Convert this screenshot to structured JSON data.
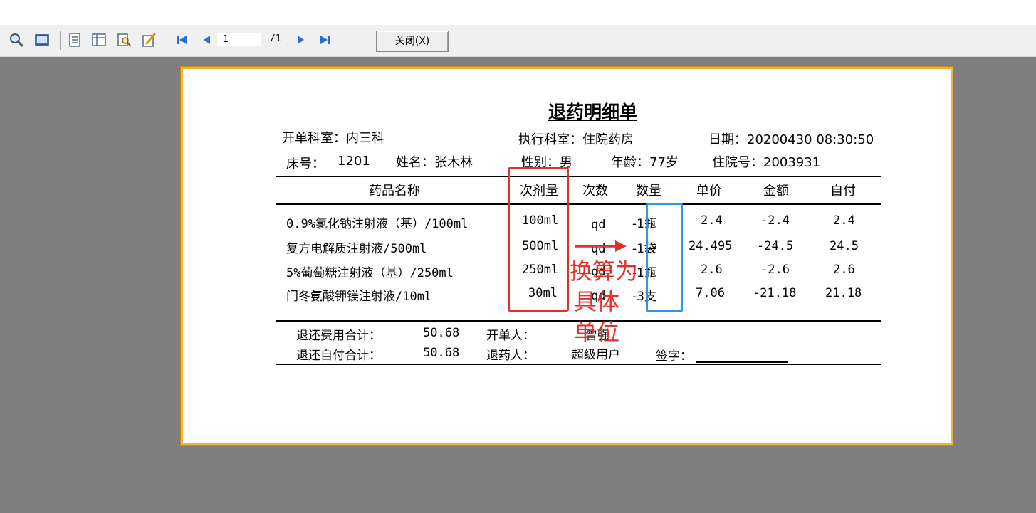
{
  "toolbar": {
    "page_current": "1",
    "page_total": "/1",
    "close_label": "关闭(X)"
  },
  "doc": {
    "title": "退药明细单",
    "dept_label": "开单科室：内三科",
    "exec_dept_label": "执行科室：住院药房",
    "date_label": "日期：20200430 08:30:50",
    "bed_label": "床号：",
    "bed_value": "1201",
    "name_label": "姓名：张木林",
    "sex_label": "性别：男",
    "age_label": "年龄：77岁",
    "admission_label": "住院号：2003931",
    "headers": [
      "药品名称",
      "次剂量",
      "次数",
      "数量",
      "单价",
      "金额",
      "自付"
    ],
    "rows": [
      {
        "name": "0.9%氯化钠注射液（基）/100ml",
        "dose": "100ml",
        "freq": "qd",
        "qty": "-1瓶",
        "price": "2.4",
        "amount": "-2.4",
        "self": "2.4"
      },
      {
        "name": "复方电解质注射液/500ml",
        "dose": "500ml",
        "freq": "qd",
        "qty": "-1袋",
        "price": "24.495",
        "amount": "-24.5",
        "self": "24.5"
      },
      {
        "name": "5%葡萄糖注射液（基）/250ml",
        "dose": "250ml",
        "freq": "qd",
        "qty": "-1瓶",
        "price": "2.6",
        "amount": "-2.6",
        "self": "2.6"
      },
      {
        "name": "门冬氨酸钾镁注射液/10ml",
        "dose": "30ml",
        "freq": "qd",
        "qty": "-3支",
        "price": "7.06",
        "amount": "-21.18",
        "self": "21.18"
      }
    ],
    "footer": {
      "refund_total_label": "退还费用合计：",
      "refund_total_value": "50.68",
      "self_total_label": "退还自付合计：",
      "self_total_value": "50.68",
      "issuer_label": "开单人：",
      "issuer_value": "曾强",
      "returner_label": "退药人：",
      "returner_value": "超级用户",
      "signature_label": "签字："
    }
  },
  "annotation": {
    "text_line1": "换算为",
    "text_line2": "具体",
    "text_line3": "单位",
    "red": "#e0312b",
    "blue": "#2e96e8"
  },
  "colors": {
    "workspace": "#7f7f7f",
    "paper_border": "#f3b43a"
  }
}
